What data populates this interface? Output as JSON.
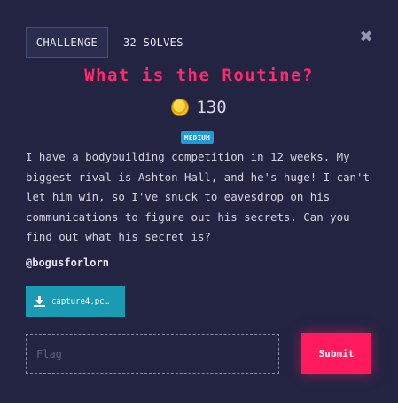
{
  "header": {
    "tab_challenge": "CHALLENGE",
    "tab_solves": "32 SOLVES"
  },
  "challenge": {
    "title": "What is the Routine?",
    "points": "130",
    "difficulty": "MEDIUM",
    "description": "I have a bodybuilding competition in 12 weeks. My biggest rival is Ashton Hall, and he's huge! I can't let him win, so I've snuck to eavesdrop on his communications to figure out his secrets. Can you find out what his secret is?",
    "author": "@bogusforlorn",
    "file_label": "capture4.pc…"
  },
  "form": {
    "flag_placeholder": "Flag",
    "submit_label": "Submit"
  },
  "colors": {
    "background": "#222442",
    "title": "#ff2a6d",
    "badge": "#1f9bd6",
    "file_button": "#1b9bb3",
    "submit": "#ff1a5e"
  },
  "icons": {
    "close": "close-icon",
    "coin": "coin-icon",
    "download": "download-icon"
  }
}
